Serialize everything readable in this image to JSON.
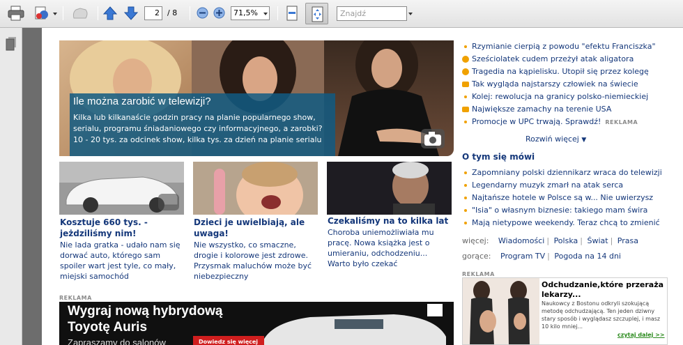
{
  "toolbar": {
    "page_current": "2",
    "page_total": "/ 8",
    "zoom": "71,5%",
    "find_placeholder": "Znajdź",
    "icons": [
      "print-icon",
      "tools-icon",
      "hand-icon",
      "prev-page-icon",
      "next-page-icon",
      "zoom-out-icon",
      "zoom-in-icon",
      "fit-width-icon",
      "fit-page-icon"
    ]
  },
  "hero": {
    "title": "Ile można zarobić w telewizji?",
    "text": "Kilka lub kilkanaście godzin pracy na planie popularnego show, serialu, programu śniadaniowego czy informacyjnego, a zarobki? 10 - 20 tys. za odcinek show, kilka tys. za dzień na planie serialu"
  },
  "articles": [
    {
      "title": "Kosztuje 660 tys. - jeżdziliśmy nim!",
      "text": "Nie lada gratka - udało nam się dorwać auto, którego sam spoiler wart jest tyle, co mały, miejski samochód"
    },
    {
      "title": "Dzieci je uwielbiają, ale uwaga!",
      "text": "Nie wszystko, co smaczne, drogie i kolorowe jest zdrowe. Przysmak maluchów może być niebezpieczny"
    },
    {
      "title": "Czekaliśmy na to kilka lat",
      "text": "Choroba uniemożliwiała mu pracę. Nowa książka jest o umieraniu, odchodzeniu... Warto było czekać"
    }
  ],
  "ad_label": "REKLAMA",
  "banner": {
    "headline1": "Wygraj nową hybrydową",
    "headline2": "Toyotę Auris",
    "sub": "Zapraszamy do salonów",
    "button": "Dowiedz się więcej ›"
  },
  "news": [
    {
      "text": "Rzymianie cierpią z powodu \"efektu Franciszka\"",
      "icon": "bullet"
    },
    {
      "text": "Sześciolatek cudem przeżył atak aligatora",
      "icon": "video-icon"
    },
    {
      "text": "Tragedia na kąpielisku. Utopił się przez kolegę",
      "icon": "video-icon"
    },
    {
      "text": "Tak wygląda najstarszy człowiek na świecie",
      "icon": "camera-icon"
    },
    {
      "text": "Kolej: rewolucja na granicy polsko-niemieckiej",
      "icon": "bullet"
    },
    {
      "text": "Największe zamachy na terenie USA",
      "icon": "camera-icon"
    },
    {
      "text": "Promocje w UPC trwają. Sprawdź!",
      "icon": "bullet",
      "tag": "REKLAMA"
    }
  ],
  "rozwin": "Rozwiń więcej",
  "otym_title": "O tym się mówi",
  "otym": [
    "Zapomniany polski dziennikarz wraca do telewizji",
    "Legendarny muzyk zmarł na atak serca",
    "Najtańsze hotele w Polsce są w... Nie uwierzysz",
    "\"Isia\" o własnym biznesie: takiego mam świra",
    "Mają nietypowe weekendy. Teraz chcą to zmienić"
  ],
  "wiecej": {
    "label": "więcej:",
    "links": [
      "Wiadomości",
      "Polska",
      "Świat",
      "Prasa"
    ]
  },
  "gorace": {
    "label": "gorące:",
    "links": [
      "Program TV",
      "Pogoda na 14 dni"
    ]
  },
  "side_ad": {
    "head": "Odchudzanie,które przeraża lekarzy...",
    "body": "Naukowcy z Bostonu odkryli szokującą metodę odchudzającą. Ten jeden dziwny stary sposób i wyglądasz szczuplej, i masz 10 kilo mniej...",
    "more": "czytaj dalej >>"
  },
  "colors": {
    "link": "#14377a",
    "bullet": "#f0a100",
    "overlay": "#105a82"
  }
}
